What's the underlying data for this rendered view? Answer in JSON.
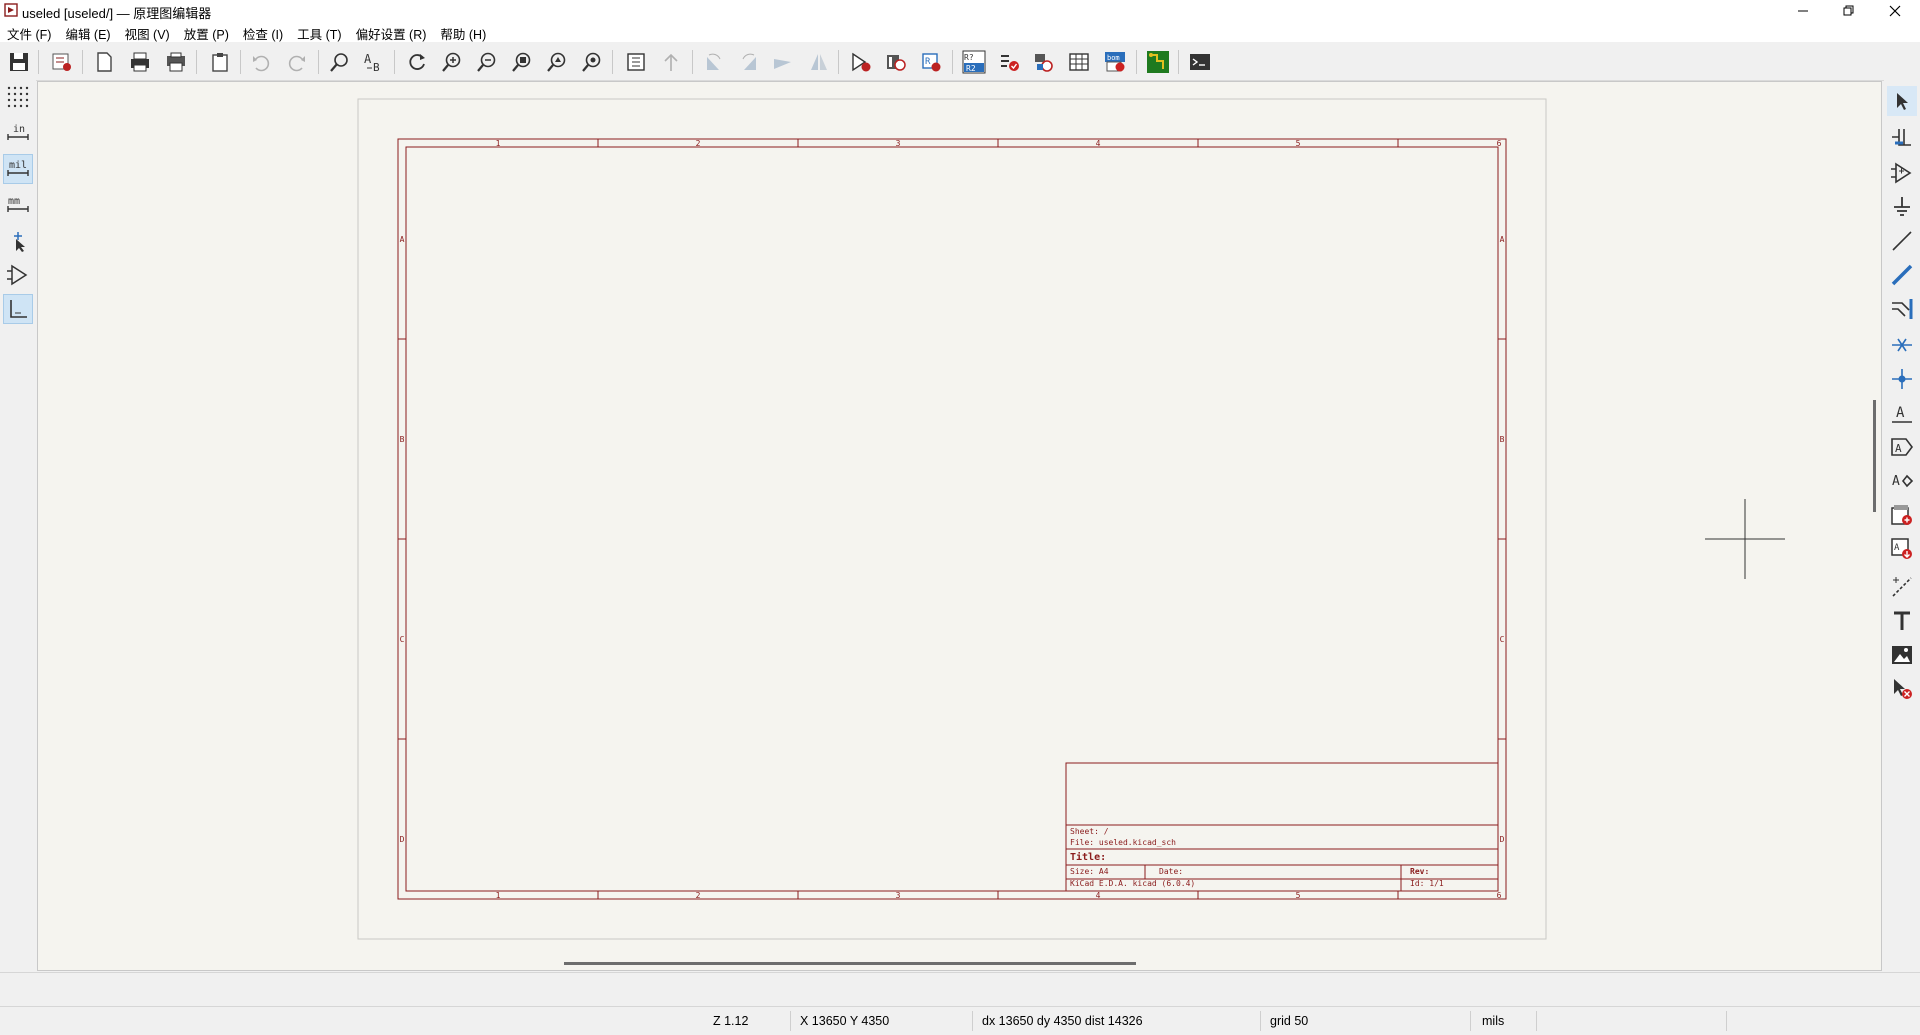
{
  "window": {
    "title": "useled [useled/] — 原理图编辑器",
    "controls": [
      "minimize",
      "restore",
      "close"
    ]
  },
  "menu": [
    "文件 (F)",
    "编辑 (E)",
    "视图 (V)",
    "放置 (P)",
    "检查 (I)",
    "工具 (T)",
    "偏好设置 (R)",
    "帮助 (H)"
  ],
  "toolbar_icons": [
    "save-icon",
    "schematic-setup-icon",
    "page-settings-icon",
    "print-icon",
    "plot-icon",
    "paste-icon",
    "undo-icon",
    "redo-icon",
    "find-icon",
    "find-replace-icon",
    "refresh-icon",
    "zoom-in-icon",
    "zoom-out-icon",
    "zoom-fit-icon",
    "zoom-objects-icon",
    "zoom-selection-icon",
    "hierarchy-navigator-icon",
    "leave-sheet-icon",
    "rotate-ccw-icon",
    "rotate-cw-icon",
    "mirror-vertical-icon",
    "mirror-horizontal-icon",
    "symbol-editor-icon",
    "symbol-browser-icon",
    "annotate-icon",
    "erc-icon",
    "symbol-fields-icon",
    "assign-footprints-icon",
    "edit-fields-table-icon",
    "bom-icon",
    "pcb-editor-icon",
    "scripting-console-icon"
  ],
  "left_tools": [
    "grid-icon",
    "inches-icon",
    "mils-icon",
    "millimeters-icon",
    "cursor-shape-icon",
    "hidden-pins-icon",
    "line-mode-icon"
  ],
  "left_labels": {
    "inches": "in",
    "mils": "mil",
    "mm": "mm"
  },
  "right_tools": [
    "select-icon",
    "highlight-net-icon",
    "add-symbol-icon",
    "add-power-icon",
    "add-wire-icon",
    "add-bus-icon",
    "add-wire-to-bus-entry-icon",
    "add-no-connect-icon",
    "add-junction-icon",
    "add-label-icon",
    "add-global-label-icon",
    "add-hierarchical-label-icon",
    "add-hierarchical-sheet-icon",
    "import-sheet-pin-icon",
    "add-graphic-line-icon",
    "add-text-icon",
    "add-image-icon",
    "delete-icon"
  ],
  "sheet": {
    "columns": [
      "1",
      "2",
      "3",
      "4",
      "5",
      "6"
    ],
    "rows": [
      "A",
      "B",
      "C",
      "D"
    ],
    "title_block": {
      "sheet": "Sheet: /",
      "file": "File: useled.kicad_sch",
      "title": "Title:",
      "size": "Size: A4",
      "date": "Date:",
      "rev": "Rev:",
      "kicad": "KiCad E.D.A.  kicad (6.0.4)",
      "id": "Id: 1/1"
    }
  },
  "status": {
    "zoom": "Z 1.12",
    "coords": "X 13650  Y 4350",
    "delta": "dx 13650  dy 4350  dist 14326",
    "grid": "grid 50",
    "units": "mils"
  },
  "colors": {
    "sheet_border": "#8a1c1c",
    "canvas": "#f5f4ef"
  }
}
